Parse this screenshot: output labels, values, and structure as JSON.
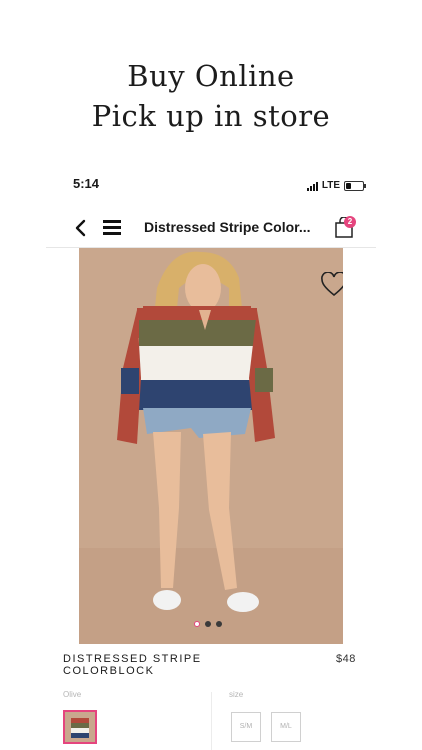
{
  "promo": {
    "line1": "Buy Online",
    "line2": "Pick up in store"
  },
  "status_bar": {
    "time": "5:14",
    "network": "LTE"
  },
  "nav": {
    "title": "Distressed Stripe Color...",
    "cart_count": "2"
  },
  "gallery": {
    "image_count": 3,
    "active_index": 0
  },
  "product": {
    "name_line1": "DISTRESSED STRIPE",
    "name_line2": "COLORBLOCK",
    "price": "$48"
  },
  "options": {
    "color_label": "Olive",
    "size_label": "size",
    "sizes": [
      "S/M",
      "M/L"
    ]
  },
  "colors": {
    "accent": "#e5457e",
    "stripe_rust": "#b2493a",
    "stripe_olive": "#6b6a45",
    "stripe_navy": "#2e4470",
    "denim": "#8fa9c4",
    "background": "#c9a78d"
  }
}
